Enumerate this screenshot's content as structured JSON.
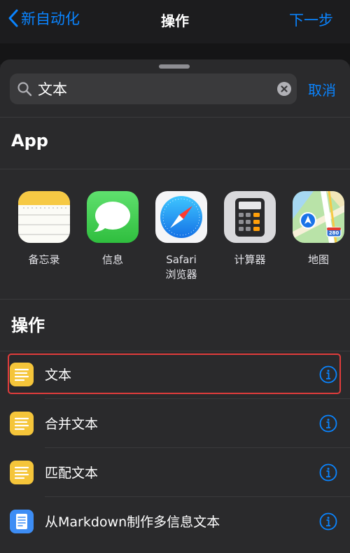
{
  "nav": {
    "back_label": "新自动化",
    "title": "操作",
    "next_label": "下一步"
  },
  "search": {
    "value": "文本",
    "cancel_label": "取消"
  },
  "apps_section": {
    "title": "App",
    "items": [
      {
        "label": "备忘录",
        "icon": "notes-app-icon"
      },
      {
        "label": "信息",
        "icon": "messages-app-icon"
      },
      {
        "label": "Safari",
        "label2": "浏览器",
        "icon": "safari-app-icon"
      },
      {
        "label": "计算器",
        "icon": "calculator-app-icon"
      },
      {
        "label": "地图",
        "icon": "maps-app-icon"
      }
    ]
  },
  "actions_section": {
    "title": "操作",
    "items": [
      {
        "label": "文本",
        "icon": "text-action-icon",
        "highlighted": true
      },
      {
        "label": "合并文本",
        "icon": "text-action-icon"
      },
      {
        "label": "匹配文本",
        "icon": "text-action-icon"
      },
      {
        "label": "从Markdown制作多信息文本",
        "icon": "rich-text-action-icon"
      }
    ]
  },
  "maps_badge": "280",
  "colors": {
    "accent": "#0a84ff",
    "highlight": "#e03c3c",
    "text_action": "#f5c53a"
  }
}
